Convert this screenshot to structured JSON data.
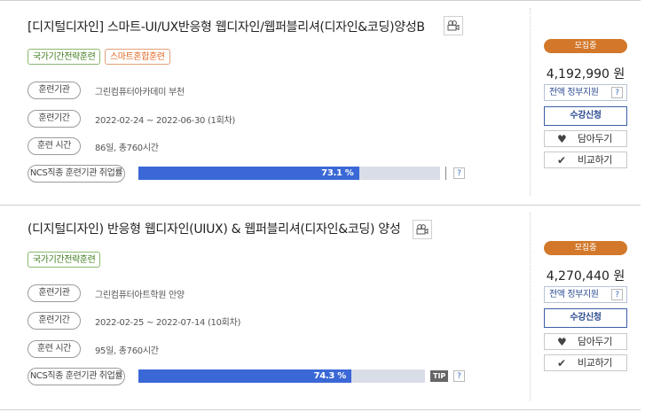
{
  "courses": [
    {
      "title": "[디지털디자인] 스마트-UI/UX반응형 웹디자인/웹퍼블리셔(디자인&코딩)양성B",
      "badges": [
        {
          "text": "국가기간전략훈련",
          "color": "green"
        },
        {
          "text": "스마트혼합훈련",
          "color": "orange"
        }
      ],
      "rows": [
        {
          "label": "훈련기관",
          "value": "그린컴퓨터아카데미 부천"
        },
        {
          "label": "훈련기간",
          "value": "2022-02-24 ~ 2022-06-30 (1회차)"
        },
        {
          "label": "훈련 시간",
          "value": "86일, 총760시간"
        }
      ],
      "ncs_label": "NCS직종 훈련기관 취업률",
      "employment_rate": 73.1,
      "employment_rate_text": "73.1 %",
      "help": "?",
      "status": "모집중",
      "price": "4,192,990 원",
      "support": "전액 정부지원",
      "apply": "수강신청",
      "save": "담아두기",
      "compare": "비교하기"
    },
    {
      "title": "(디지털디자인) 반응형 웹디자인(UIUX) & 웹퍼블리셔(디자인&코딩) 양성",
      "badges": [
        {
          "text": "국가기간전략훈련",
          "color": "green"
        }
      ],
      "rows": [
        {
          "label": "훈련기관",
          "value": "그린컴퓨터아트학원 안양"
        },
        {
          "label": "훈련기간",
          "value": "2022-02-25 ~ 2022-07-14 (10회차)"
        },
        {
          "label": "훈련 시간",
          "value": "95일, 총760시간"
        }
      ],
      "ncs_label": "NCS직종 훈련기관 취업률",
      "employment_rate": 74.3,
      "employment_rate_text": "74.3 %",
      "tip": "TIP",
      "help": "?",
      "status": "모집중",
      "price": "4,270,440 원",
      "support": "전액 정부지원",
      "apply": "수강신청",
      "save": "담아두기",
      "compare": "비교하기"
    }
  ],
  "colors": {
    "status": "#d3782a",
    "progress": "#3a68d6",
    "progress_track": "#d9dde7",
    "badge_green": "#3f7d1d",
    "badge_orange": "#e0641e",
    "link_blue": "#2e4d93"
  },
  "icons": {
    "video": "video-camera-icon",
    "heart": "heart-icon",
    "check": "check-icon",
    "help": "question-icon"
  }
}
